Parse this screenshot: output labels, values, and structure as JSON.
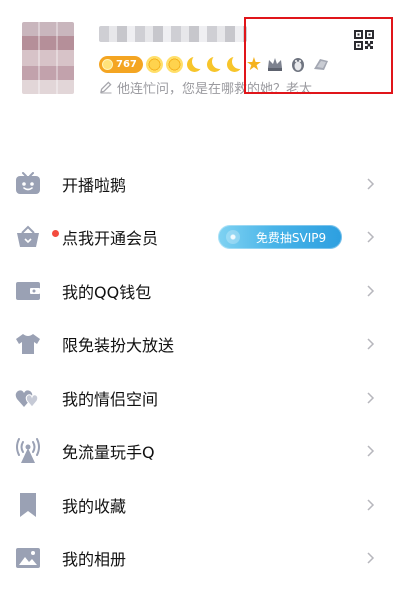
{
  "profile": {
    "level_badge": "767",
    "signature": "他连忙问，您是在哪救的她？老太"
  },
  "menu": {
    "items": [
      {
        "label": "开播啦鹅",
        "icon": "tv-icon"
      },
      {
        "label": "点我开通会员",
        "icon": "vip-basket-icon",
        "promo": "免费抽SVIP9"
      },
      {
        "label": "我的QQ钱包",
        "icon": "wallet-icon"
      },
      {
        "label": "限免装扮大放送",
        "icon": "shirt-icon"
      },
      {
        "label": "我的情侣空间",
        "icon": "couple-hearts-icon"
      },
      {
        "label": "免流量玩手Q",
        "icon": "signal-tower-icon"
      },
      {
        "label": "我的收藏",
        "icon": "bookmark-icon"
      },
      {
        "label": "我的相册",
        "icon": "photo-album-icon"
      }
    ]
  },
  "colors": {
    "icon_gray": "#9aa1b4",
    "highlight_border": "#e0151a",
    "accent_orange": "#f4a522",
    "promo_blue": "#2d9fe0",
    "notification_red": "#f34b3e"
  }
}
